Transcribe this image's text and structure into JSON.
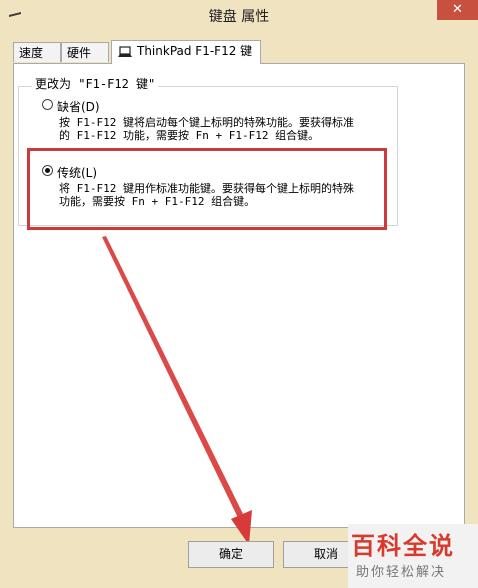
{
  "window": {
    "title": "键盘 属性",
    "close_label": "✕"
  },
  "tabs": [
    {
      "label": "速度"
    },
    {
      "label": "硬件"
    },
    {
      "label": "ThinkPad F1-F12 键"
    }
  ],
  "group": {
    "title": "更改为 \"F1-F12 键\""
  },
  "options": [
    {
      "label": "缺省(D)",
      "checked": false,
      "desc_line1": "按 F1-F12 键将启动每个键上标明的特殊功能。要获得标准",
      "desc_line2": "的 F1-F12 功能，需要按 Fn + F1-F12 组合键。"
    },
    {
      "label": "传统(L)",
      "checked": true,
      "desc_line1": "将 F1-F12 键用作标准功能键。要获得每个键上标明的特殊",
      "desc_line2": "功能，需要按 Fn + F1-F12 组合键。"
    }
  ],
  "buttons": {
    "ok": "确定",
    "cancel": "取消"
  },
  "annotation": {
    "color": "#cc3a3a"
  },
  "watermark": {
    "title": "百科全说",
    "subtitle": "助你轻松解决"
  }
}
